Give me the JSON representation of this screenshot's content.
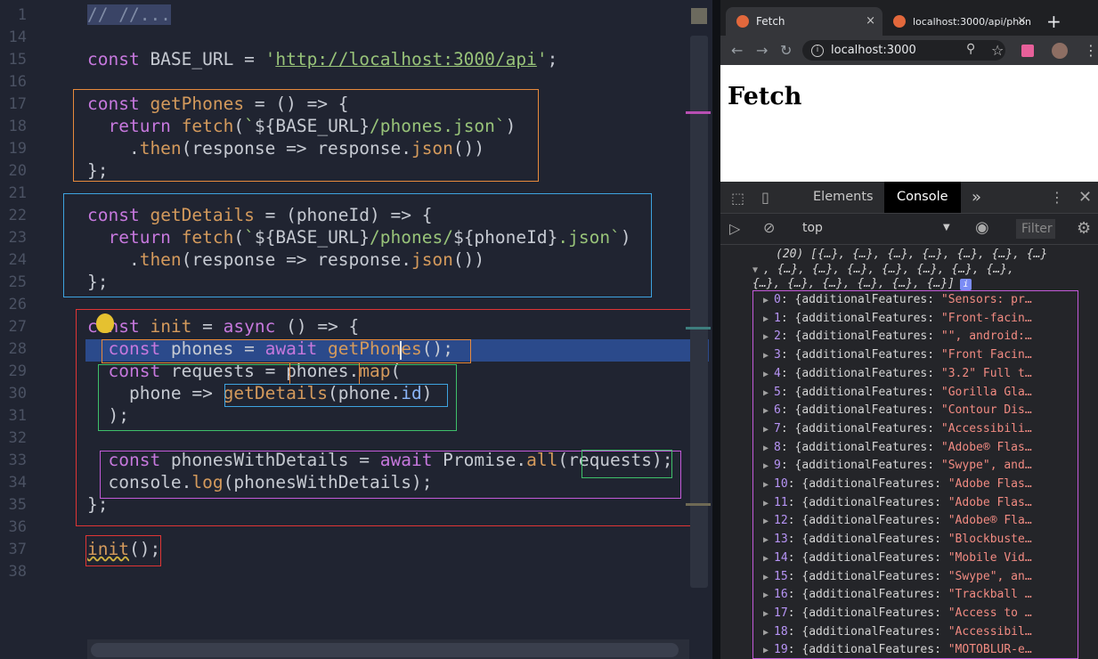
{
  "editor": {
    "lines": [
      {
        "n": "1",
        "segs": [
          {
            "t": "// //...",
            "c": "cm cm-bg"
          }
        ]
      },
      {
        "n": "14",
        "segs": []
      },
      {
        "n": "15",
        "segs": [
          {
            "t": "const",
            "c": "kw"
          },
          {
            "t": " BASE_URL "
          },
          {
            "t": "="
          },
          {
            "t": " "
          },
          {
            "t": "'",
            "c": "str"
          },
          {
            "t": "http://localhost:3000/api",
            "c": "url"
          },
          {
            "t": "'",
            "c": "str"
          },
          {
            "t": ";"
          }
        ]
      },
      {
        "n": "16",
        "segs": []
      },
      {
        "n": "17",
        "segs": [
          {
            "t": "const",
            "c": "kw"
          },
          {
            "t": " "
          },
          {
            "t": "getPhones",
            "c": "fn"
          },
          {
            "t": " = () => {"
          }
        ]
      },
      {
        "n": "18",
        "segs": [
          {
            "t": "  "
          },
          {
            "t": "return",
            "c": "kw"
          },
          {
            "t": " "
          },
          {
            "t": "fetch",
            "c": "fn"
          },
          {
            "t": "("
          },
          {
            "t": "`",
            "c": "str"
          },
          {
            "t": "${BASE_URL}"
          },
          {
            "t": "/phones.json`",
            "c": "str"
          },
          {
            "t": ")"
          }
        ]
      },
      {
        "n": "19",
        "segs": [
          {
            "t": "    ."
          },
          {
            "t": "then",
            "c": "fn"
          },
          {
            "t": "(response => response."
          },
          {
            "t": "json",
            "c": "fn"
          },
          {
            "t": "())"
          }
        ]
      },
      {
        "n": "20",
        "segs": [
          {
            "t": "};"
          }
        ]
      },
      {
        "n": "21",
        "segs": []
      },
      {
        "n": "22",
        "segs": [
          {
            "t": "const",
            "c": "kw"
          },
          {
            "t": " "
          },
          {
            "t": "getDetails",
            "c": "fn"
          },
          {
            "t": " = (phoneId) => {"
          }
        ]
      },
      {
        "n": "23",
        "segs": [
          {
            "t": "  "
          },
          {
            "t": "return",
            "c": "kw"
          },
          {
            "t": " "
          },
          {
            "t": "fetch",
            "c": "fn"
          },
          {
            "t": "("
          },
          {
            "t": "`",
            "c": "str"
          },
          {
            "t": "${BASE_URL}"
          },
          {
            "t": "/phones/",
            "c": "str"
          },
          {
            "t": "${phoneId}"
          },
          {
            "t": ".json`",
            "c": "str"
          },
          {
            "t": ")"
          }
        ]
      },
      {
        "n": "24",
        "segs": [
          {
            "t": "    ."
          },
          {
            "t": "then",
            "c": "fn"
          },
          {
            "t": "(response => response."
          },
          {
            "t": "json",
            "c": "fn"
          },
          {
            "t": "())"
          }
        ]
      },
      {
        "n": "25",
        "segs": [
          {
            "t": "};"
          }
        ]
      },
      {
        "n": "26",
        "segs": []
      },
      {
        "n": "27",
        "segs": [
          {
            "t": "const",
            "c": "kw"
          },
          {
            "t": " "
          },
          {
            "t": "init",
            "c": "fn"
          },
          {
            "t": " = "
          },
          {
            "t": "async",
            "c": "kw"
          },
          {
            "t": " () => {"
          }
        ]
      },
      {
        "n": "28",
        "segs": [
          {
            "t": "  "
          },
          {
            "t": "const",
            "c": "kw"
          },
          {
            "t": " phones = "
          },
          {
            "t": "await",
            "c": "kw"
          },
          {
            "t": " "
          },
          {
            "t": "getPhones",
            "c": "fn"
          },
          {
            "t": "();"
          }
        ]
      },
      {
        "n": "29",
        "segs": [
          {
            "t": "  "
          },
          {
            "t": "const",
            "c": "kw"
          },
          {
            "t": " requests = phones."
          },
          {
            "t": "map",
            "c": "fn"
          },
          {
            "t": "("
          }
        ]
      },
      {
        "n": "30",
        "segs": [
          {
            "t": "    phone => "
          },
          {
            "t": "getDetails",
            "c": "fn"
          },
          {
            "t": "(phone."
          },
          {
            "t": "id",
            "c": "prop"
          },
          {
            "t": ")"
          }
        ]
      },
      {
        "n": "31",
        "segs": [
          {
            "t": "  );"
          }
        ]
      },
      {
        "n": "32",
        "segs": []
      },
      {
        "n": "33",
        "segs": [
          {
            "t": "  "
          },
          {
            "t": "const",
            "c": "kw"
          },
          {
            "t": " phonesWithDetails = "
          },
          {
            "t": "await",
            "c": "kw"
          },
          {
            "t": " Promise."
          },
          {
            "t": "all",
            "c": "fn"
          },
          {
            "t": "(requests);"
          }
        ]
      },
      {
        "n": "34",
        "segs": [
          {
            "t": "  console."
          },
          {
            "t": "log",
            "c": "fn"
          },
          {
            "t": "(phonesWithDetails);"
          }
        ]
      },
      {
        "n": "35",
        "segs": [
          {
            "t": "};"
          }
        ]
      },
      {
        "n": "36",
        "segs": []
      },
      {
        "n": "37",
        "segs": [
          {
            "t": "init",
            "c": "fn squig"
          },
          {
            "t": "();"
          }
        ]
      },
      {
        "n": "38",
        "segs": []
      }
    ]
  },
  "browser": {
    "tabs": [
      {
        "label": "Fetch",
        "close": "×"
      },
      {
        "label": "localhost:3000/api/phon",
        "close": "×"
      }
    ],
    "new_tab": "+",
    "url": "localhost:3000",
    "page_heading": "Fetch",
    "devtools": {
      "tabs": [
        "Elements",
        "Console",
        "»"
      ],
      "context": "top",
      "filter": "Filter",
      "summary_lines": [
        "(20) [{…}, {…}, {…}, {…}, {…}, {…}, {…}",
        ", {…}, {…}, {…}, {…}, {…}, {…}, {…},",
        "{…}, {…}, {…}, {…}, {…}, {…}]"
      ],
      "info_badge": "i",
      "entries": [
        {
          "i": "0",
          "v": "\"Sensors: pr…"
        },
        {
          "i": "1",
          "v": "\"Front-facin…"
        },
        {
          "i": "2",
          "v": "\"\", android:…"
        },
        {
          "i": "3",
          "v": "\"Front Facin…"
        },
        {
          "i": "4",
          "v": "\"3.2\" Full t…"
        },
        {
          "i": "5",
          "v": "\"Gorilla Gla…"
        },
        {
          "i": "6",
          "v": "\"Contour Dis…"
        },
        {
          "i": "7",
          "v": "\"Accessibili…"
        },
        {
          "i": "8",
          "v": "\"Adobe® Flas…"
        },
        {
          "i": "9",
          "v": "\"Swype\", and…"
        },
        {
          "i": "10",
          "v": "\"Adobe Flas…"
        },
        {
          "i": "11",
          "v": "\"Adobe Flas…"
        },
        {
          "i": "12",
          "v": "\"Adobe® Fla…"
        },
        {
          "i": "13",
          "v": "\"Blockbuste…"
        },
        {
          "i": "14",
          "v": "\"Mobile Vid…"
        },
        {
          "i": "15",
          "v": "\"Swype\", an…"
        },
        {
          "i": "16",
          "v": "\"Trackball …"
        },
        {
          "i": "17",
          "v": "\"Access to …"
        },
        {
          "i": "18",
          "v": "\"Accessibil…"
        },
        {
          "i": "19",
          "v": "\"MOTOBLUR-e…"
        }
      ],
      "entry_key": "additionalFeatures"
    }
  },
  "colors": {
    "box_orange": "#e88a3c",
    "box_blue": "#3ea3e0",
    "box_red": "#e03535",
    "box_green": "#3fc06a",
    "box_magenta": "#c35ad9"
  }
}
